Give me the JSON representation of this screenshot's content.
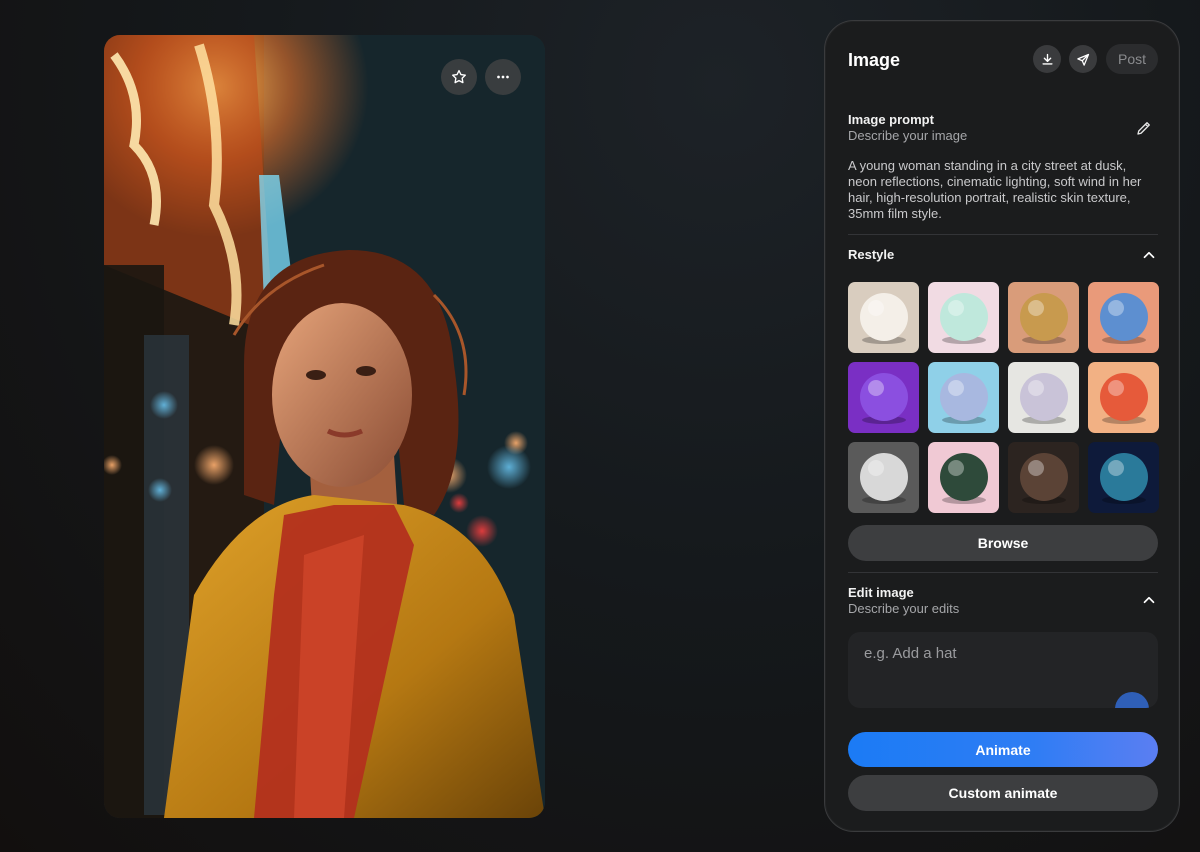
{
  "panel": {
    "title": "Image",
    "post_label": "Post"
  },
  "prompt_section": {
    "title": "Image prompt",
    "subtitle": "Describe your image",
    "text": "A young woman standing in a city street at dusk, neon reflections, cinematic lighting, soft wind in her hair, high-resolution portrait, realistic skin texture, 35mm film style."
  },
  "restyle": {
    "title": "Restyle",
    "browse_label": "Browse",
    "styles": [
      {
        "name": "plain-white-sphere",
        "bg": "#d9cdbf",
        "ball": "#f4efe8"
      },
      {
        "name": "cute-face-sphere",
        "bg": "#f1dbe3",
        "ball": "#bfe8dc"
      },
      {
        "name": "collage-sphere",
        "bg": "#d99c7a",
        "ball": "#c89a4e"
      },
      {
        "name": "psychedelic-sphere",
        "bg": "#e99a7a",
        "ball": "#5d8fd0"
      },
      {
        "name": "lowpoly-purple-sphere",
        "bg": "#7a2fc4",
        "ball": "#8b4fe0"
      },
      {
        "name": "pastel-gradient-sphere",
        "bg": "#8fd0e8",
        "ball": "#a8b8e0"
      },
      {
        "name": "paper-flower-sphere",
        "bg": "#e6e6e2",
        "ball": "#c9c3d8"
      },
      {
        "name": "striped-beach-ball",
        "bg": "#f2b184",
        "ball": "#e65a3a"
      },
      {
        "name": "line-art-sphere",
        "bg": "#5a5a5a",
        "ball": "#d8d8d8"
      },
      {
        "name": "ornate-eye-sphere",
        "bg": "#f0c9d4",
        "ball": "#2e4a3a"
      },
      {
        "name": "dark-clay-sphere",
        "bg": "#2c2420",
        "ball": "#5b4336"
      },
      {
        "name": "neon-glow-sphere",
        "bg": "#0e1a3a",
        "ball": "#2a7a9a"
      }
    ]
  },
  "edit_section": {
    "title": "Edit image",
    "subtitle": "Describe your edits",
    "placeholder": "e.g. Add a hat"
  },
  "actions": {
    "animate_label": "Animate",
    "custom_animate_label": "Custom animate"
  },
  "colors": {
    "accent": "#1b7bf5",
    "panel_bg": "#1b1c1d"
  },
  "icons": {
    "photo": [
      "star-icon",
      "more-icon"
    ],
    "header": [
      "download-icon",
      "send-icon"
    ],
    "prompt": "pencil-icon",
    "sections": "chevron-up-icon"
  }
}
